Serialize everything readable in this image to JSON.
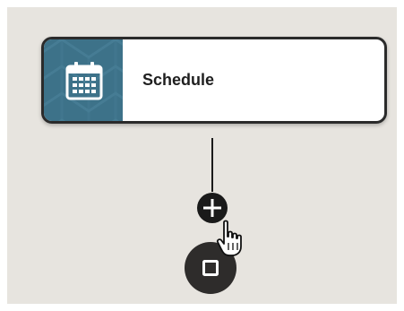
{
  "node": {
    "label": "Schedule",
    "icon": "calendar-icon",
    "icon_tile_color": "#3d7289"
  },
  "connector": {
    "add_icon": "plus-icon"
  },
  "cursor": {
    "icon": "hand-pointer-icon"
  },
  "end_node": {
    "icon": "stop-square-icon"
  },
  "colors": {
    "canvas_background": "#e7e4df",
    "node_border": "#2b2b2b",
    "connector": "#1a1a1a",
    "end_node": "#2e2c2b"
  }
}
